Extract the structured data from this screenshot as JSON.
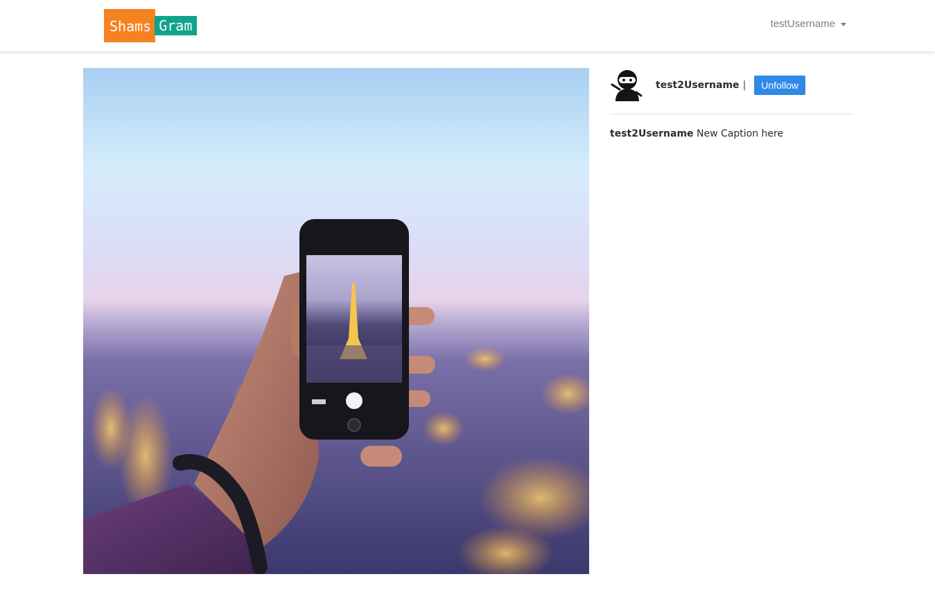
{
  "navbar": {
    "logo_part_1": "Shams",
    "logo_part_2": "Gram",
    "current_user": "testUsername",
    "colors": {
      "logo_orange": "#f58220",
      "logo_teal": "#0fa38a"
    }
  },
  "post": {
    "image_icon": "photo-of-hand-holding-phone-over-paris",
    "author": {
      "username": "test2Username",
      "separator": "|",
      "avatar_icon": "ninja-avatar-icon",
      "follow_button_label": "Unfollow"
    },
    "caption": {
      "username": "test2Username",
      "text": "New Caption here"
    },
    "colors": {
      "button_blue": "#2f8ae5"
    }
  }
}
